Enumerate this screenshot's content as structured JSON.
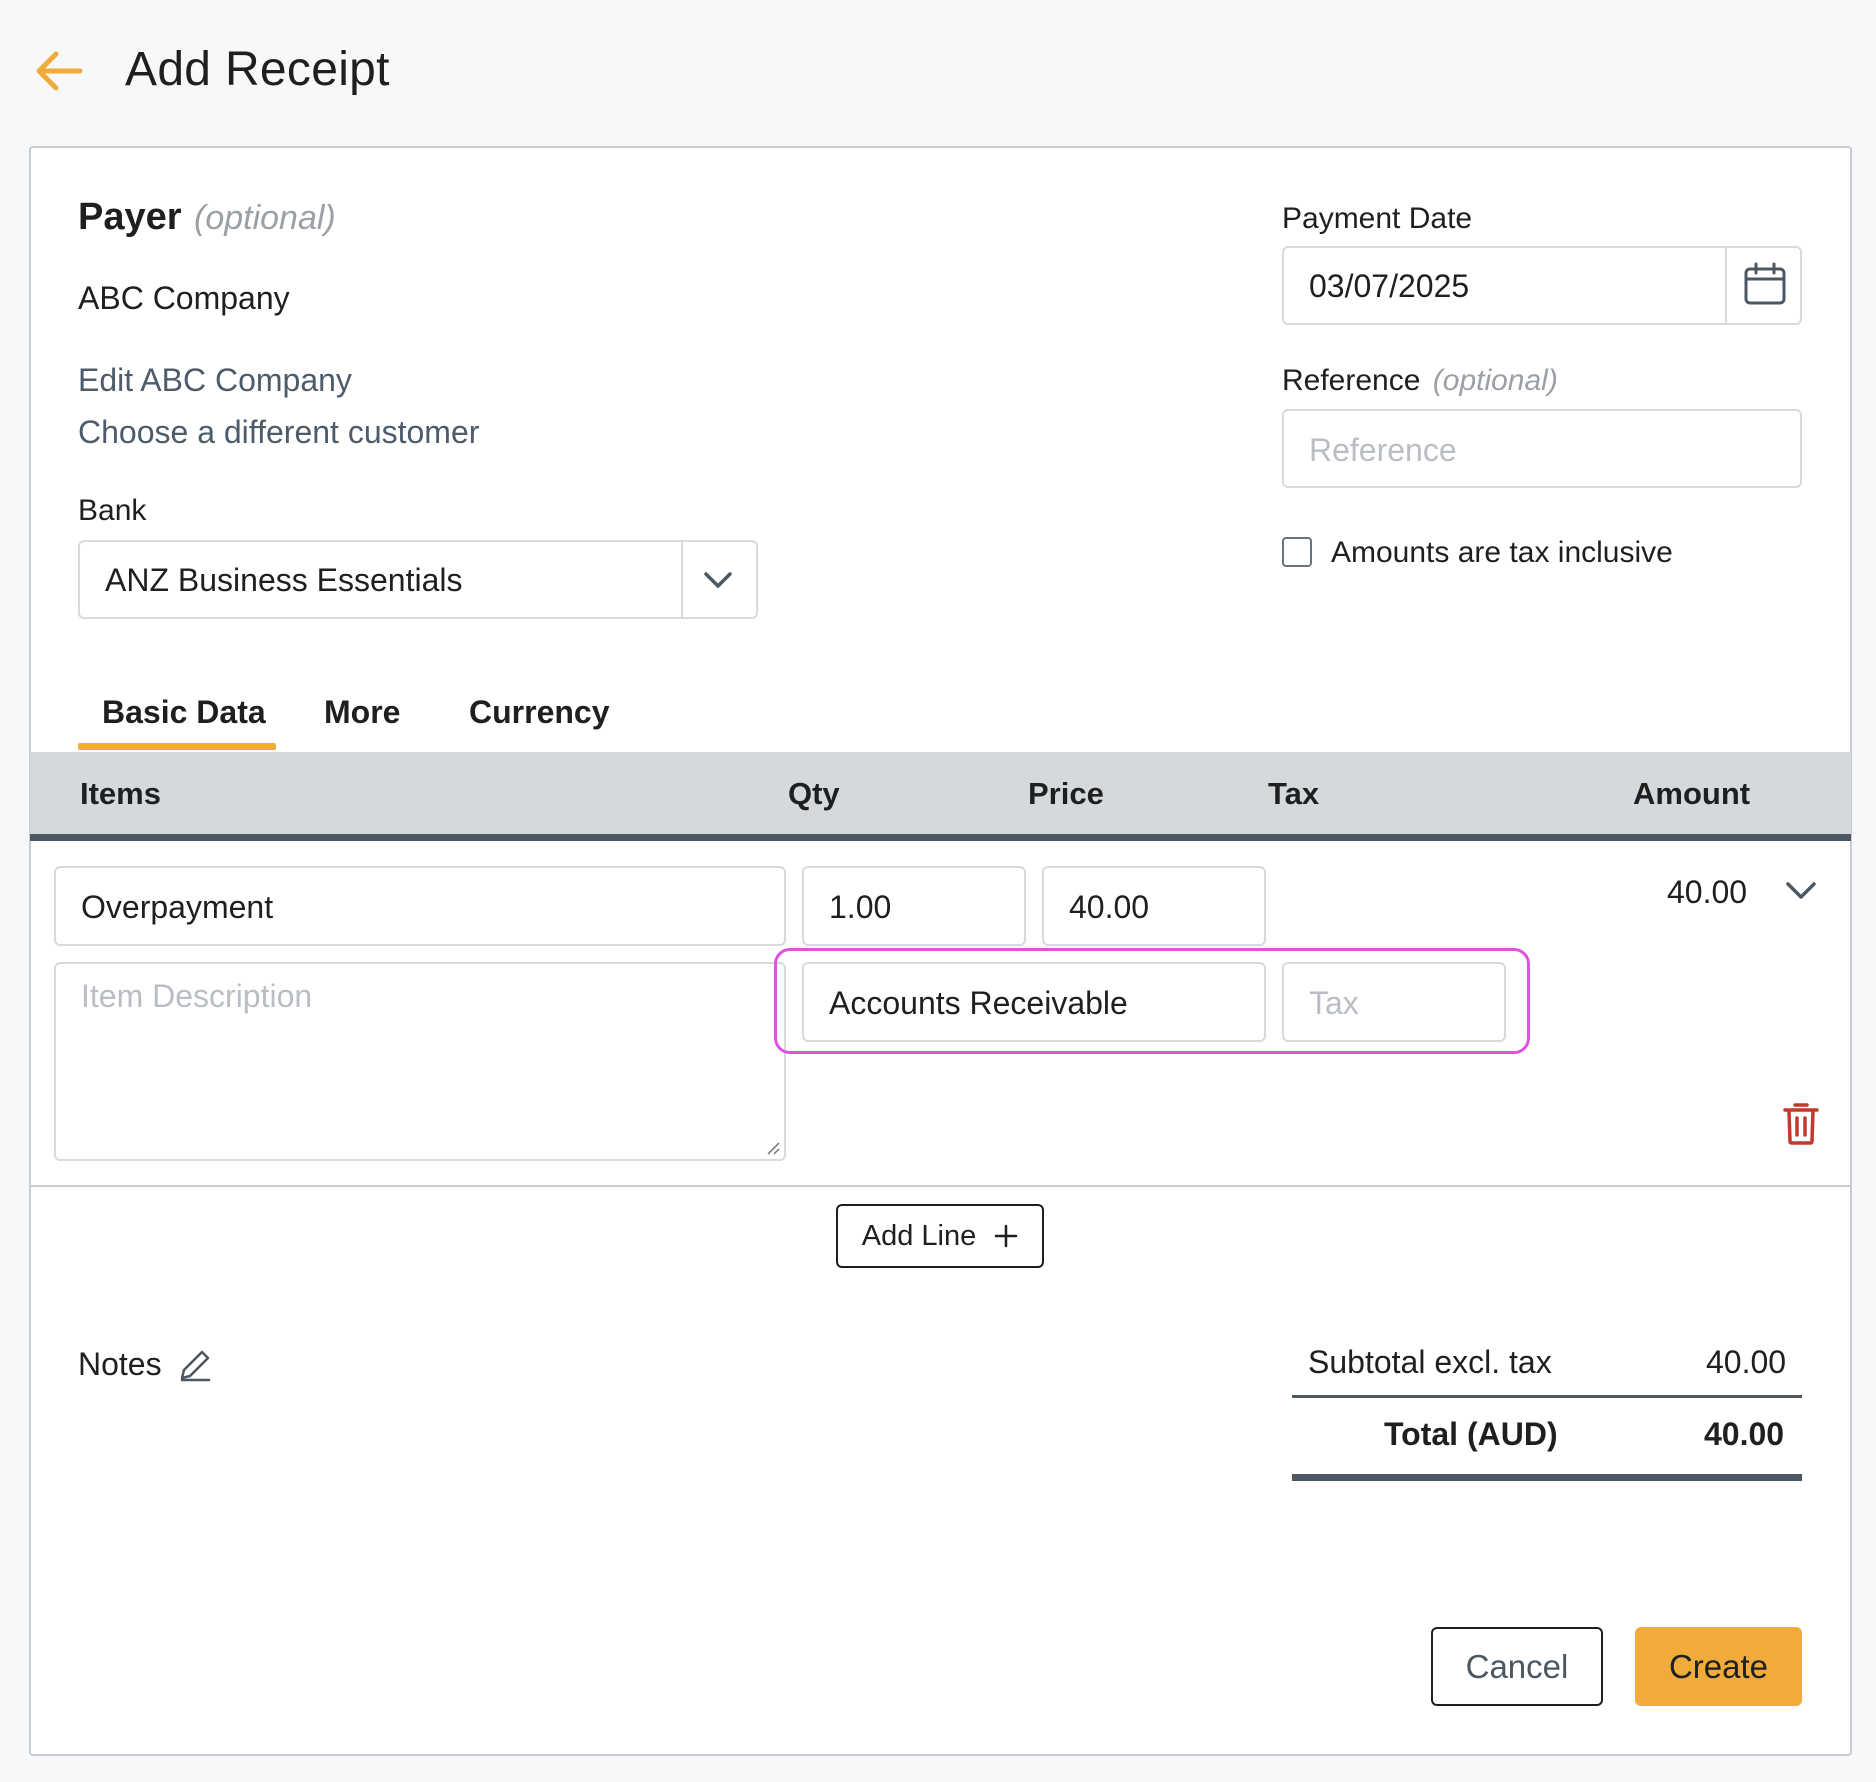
{
  "header": {
    "title": "Add Receipt"
  },
  "payer": {
    "label": "Payer",
    "optional": "(optional)",
    "name": "ABC Company",
    "edit_link": "Edit ABC Company",
    "choose_link": "Choose a different customer"
  },
  "bank": {
    "label": "Bank",
    "value": "ANZ Business Essentials"
  },
  "payment_date": {
    "label": "Payment Date",
    "value": "03/07/2025"
  },
  "reference": {
    "label": "Reference",
    "optional": "(optional)",
    "placeholder": "Reference"
  },
  "tax_inclusive": {
    "label": "Amounts are tax inclusive",
    "checked": false
  },
  "tabs": [
    {
      "label": "Basic Data",
      "active": true
    },
    {
      "label": "More",
      "active": false
    },
    {
      "label": "Currency",
      "active": false
    }
  ],
  "table": {
    "headers": {
      "items": "Items",
      "qty": "Qty",
      "price": "Price",
      "tax": "Tax",
      "amount": "Amount"
    },
    "row": {
      "item": "Overpayment",
      "qty": "1.00",
      "price": "40.00",
      "amount": "40.00",
      "description_placeholder": "Item Description",
      "account": "Accounts Receivable",
      "tax_placeholder": "Tax"
    }
  },
  "add_line": {
    "label": "Add Line"
  },
  "notes": {
    "label": "Notes"
  },
  "totals": {
    "subtotal_label": "Subtotal excl. tax",
    "subtotal_value": "40.00",
    "total_label": "Total (AUD)",
    "total_value": "40.00"
  },
  "actions": {
    "cancel": "Cancel",
    "create": "Create"
  },
  "colors": {
    "accent": "#f0ab3a",
    "highlight": "#e052e0",
    "danger": "#c0392b",
    "header_bg": "#d3d9dc"
  }
}
